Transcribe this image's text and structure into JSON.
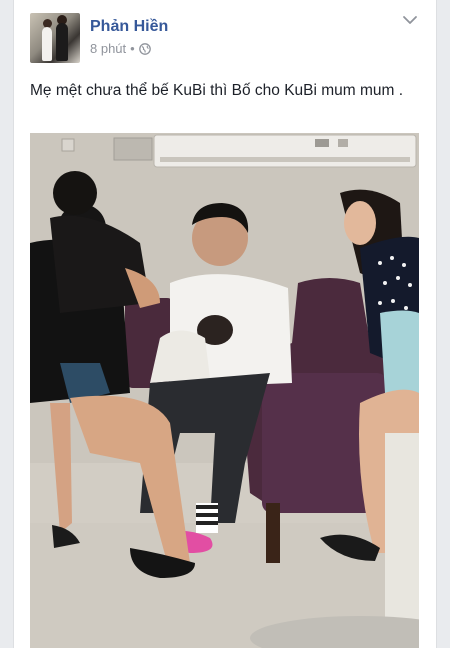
{
  "post": {
    "author": "Phản Hiền",
    "time": "8 phút",
    "separator": "•",
    "privacy_icon": "globe-icon",
    "menu_icon": "chevron-down-icon",
    "text": "Mẹ mệt chưa thể bế KuBi thì Bố cho KuBi mum mum ."
  },
  "colors": {
    "author_link": "#365899",
    "meta_gray": "#90949c",
    "text": "#1d2129",
    "background": "#e9ebee"
  }
}
